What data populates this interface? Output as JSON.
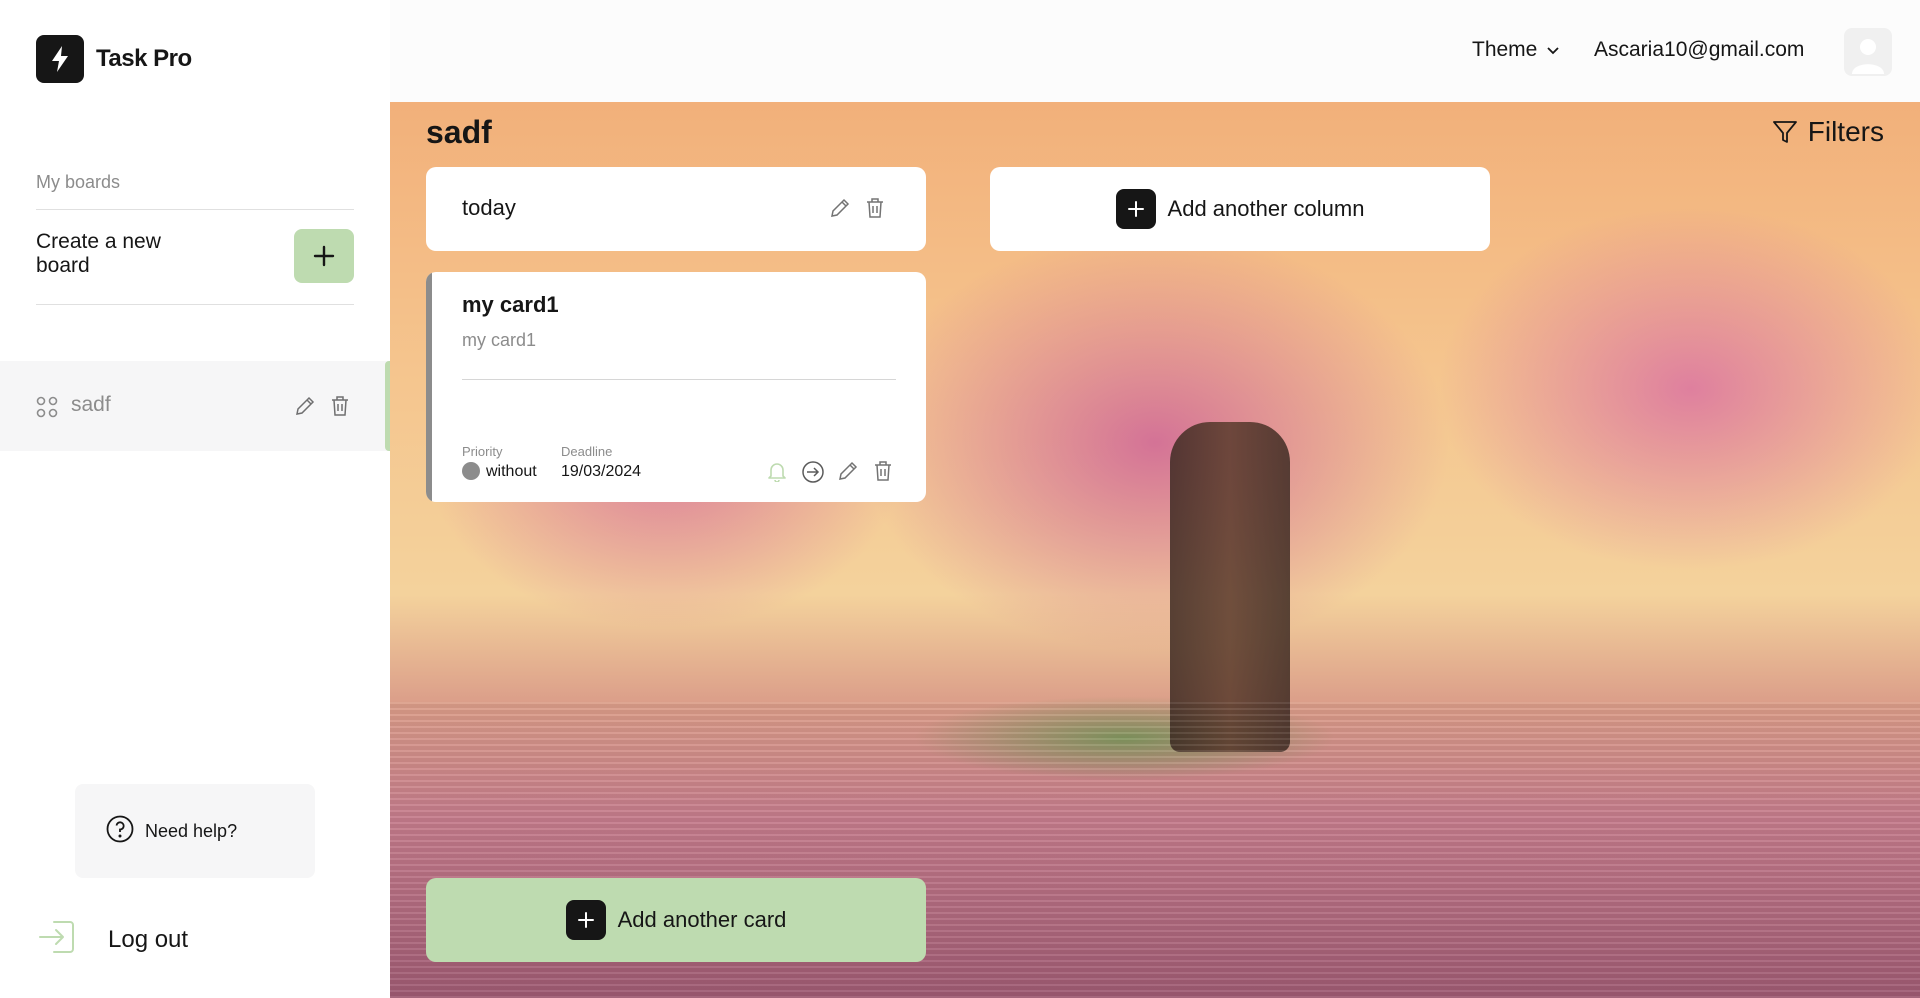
{
  "app": {
    "name": "Task Pro"
  },
  "sidebar": {
    "section_label": "My boards",
    "create_board_label": "Create a new board",
    "boards": [
      {
        "name": "sadf"
      }
    ],
    "help_label": "Need help?",
    "logout_label": "Log out"
  },
  "header": {
    "theme_label": "Theme",
    "user_email": "Ascaria10@gmail.com"
  },
  "board": {
    "title": "sadf",
    "filters_label": "Filters",
    "columns": [
      {
        "title": "today",
        "cards": [
          {
            "title": "my card1",
            "description": "my card1",
            "priority_label": "Priority",
            "priority_value": "without",
            "deadline_label": "Deadline",
            "deadline_value": "19/03/2024"
          }
        ],
        "add_card_label": "Add another card"
      }
    ],
    "add_column_label": "Add another column"
  },
  "colors": {
    "accent": "#bedbb0",
    "dark": "#161616",
    "muted": "#8c8c8c",
    "priority_without": "#8c8c8c"
  },
  "icons": [
    "lightning-icon",
    "plus-icon",
    "grid-icon",
    "pencil-icon",
    "trash-icon",
    "help-icon",
    "logout-icon",
    "chevron-down-icon",
    "user-icon",
    "filter-icon",
    "bell-icon",
    "move-arrow-icon"
  ]
}
